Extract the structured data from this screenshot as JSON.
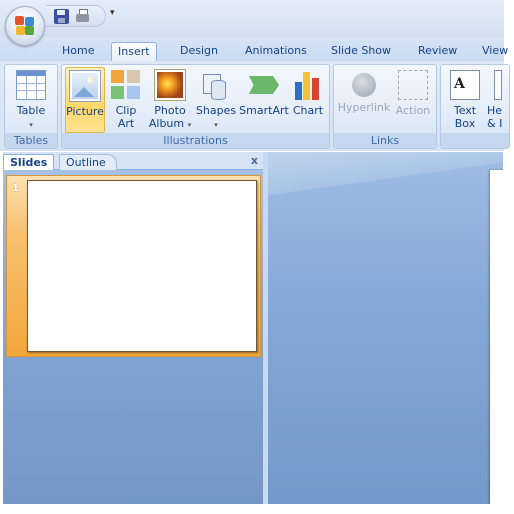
{
  "quick_access": {
    "more_glyph": "▾"
  },
  "tabs": [
    {
      "label": "Home",
      "active": false
    },
    {
      "label": "Insert",
      "active": true
    },
    {
      "label": "Design",
      "active": false
    },
    {
      "label": "Animations",
      "active": false
    },
    {
      "label": "Slide Show",
      "active": false
    },
    {
      "label": "Review",
      "active": false
    },
    {
      "label": "View",
      "active": false
    }
  ],
  "ribbon": {
    "groups": {
      "tables": {
        "label": "Tables",
        "buttons": [
          {
            "label": "Table",
            "dropdown": "▾"
          }
        ]
      },
      "illustrations": {
        "label": "Illustrations",
        "buttons": [
          {
            "label": "Picture"
          },
          {
            "label": "Clip",
            "label2": "Art"
          },
          {
            "label": "Photo",
            "label2": "Album",
            "dropdown": "▾"
          },
          {
            "label": "Shapes",
            "dropdown": "▾"
          },
          {
            "label": "SmartArt"
          },
          {
            "label": "Chart"
          }
        ]
      },
      "links": {
        "label": "Links",
        "buttons": [
          {
            "label": "Hyperlink"
          },
          {
            "label": "Action"
          }
        ]
      },
      "text": {
        "buttons": [
          {
            "label": "Text",
            "label2": "Box"
          },
          {
            "label": "He",
            "label2": "& I"
          }
        ]
      }
    }
  },
  "left_pane": {
    "tabs": [
      {
        "label": "Slides",
        "active": true
      },
      {
        "label": "Outline",
        "active": false
      }
    ],
    "close_glyph": "x",
    "slides": [
      {
        "number": "1"
      }
    ]
  }
}
